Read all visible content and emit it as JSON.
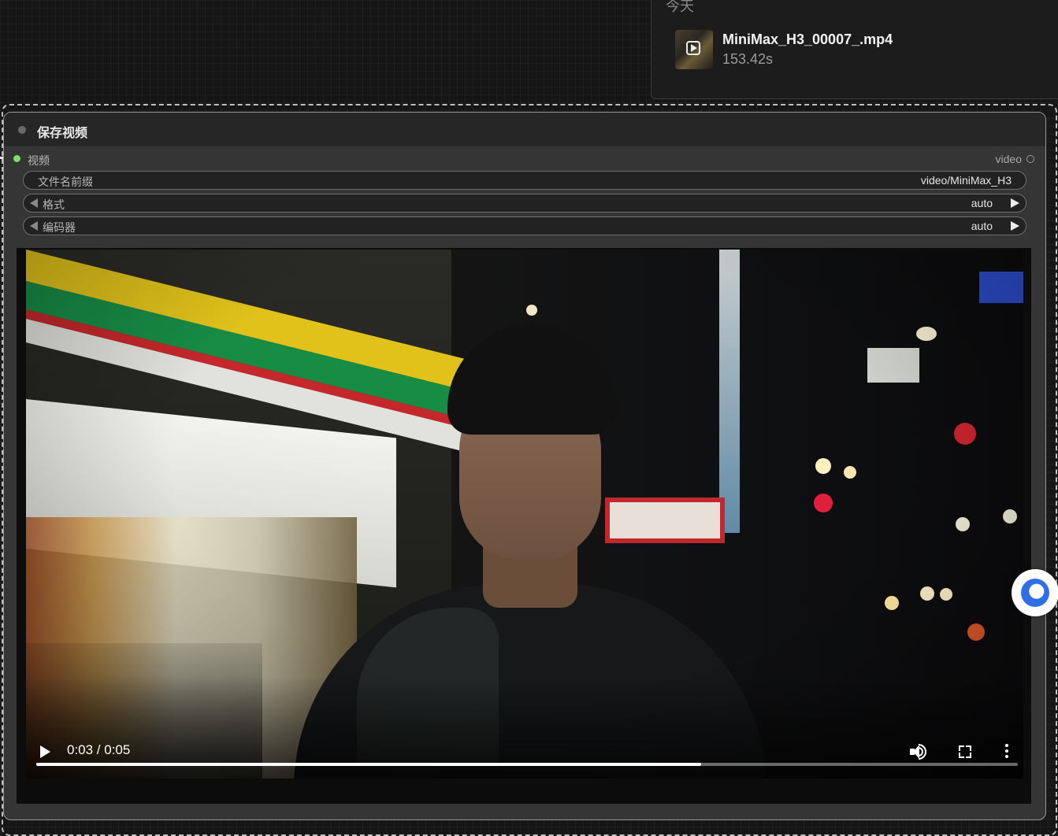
{
  "history": {
    "day_label": "今天",
    "item": {
      "filename": "MiniMax_H3_00007_.mp4",
      "duration": "153.42s"
    }
  },
  "node": {
    "title": "保存视频",
    "input_label": "视频",
    "output_label": "video",
    "widgets": {
      "filename_prefix": {
        "label": "文件名前缀",
        "value": "video/MiniMax_H3"
      },
      "format": {
        "label": "格式",
        "value": "auto"
      },
      "codec": {
        "label": "编码器",
        "value": "auto"
      }
    }
  },
  "player": {
    "time_display": "0:03 / 0:05",
    "progress_fraction": 0.677
  },
  "icons": {
    "play": "play-icon",
    "volume": "volume-icon",
    "fullscreen": "fullscreen-icon",
    "more": "more-vertical-icon",
    "assistant": "assistant-bubble-icon"
  },
  "colors": {
    "input_connected": "#7ddf66",
    "canvas_bg": "#161616",
    "node_bg": "#353535",
    "assistant_accent": "#2f6fe6"
  }
}
